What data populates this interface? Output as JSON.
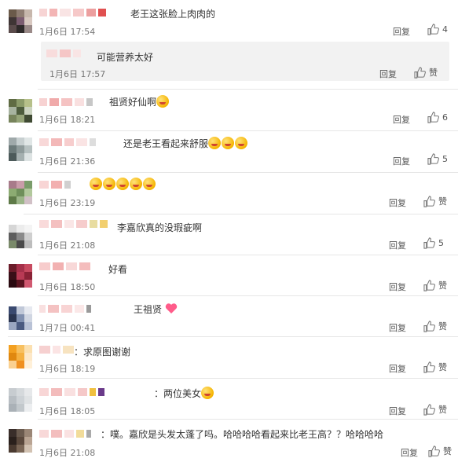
{
  "reply_label": "回复",
  "like_label": "赞",
  "comments": [
    {
      "text": "老王这张脸上肉肉的",
      "time": "1月6日 17:54",
      "likes": "4",
      "emoji_count": 0
    },
    {
      "text": "可能营养太好",
      "time": "1月6日 17:57",
      "likes": "赞",
      "emoji_count": 0,
      "is_reply": true
    },
    {
      "text": "祖贤好仙啊",
      "time": "1月6日 18:21",
      "likes": "6",
      "emoji_count": 1
    },
    {
      "text": "还是老王看起来舒服",
      "time": "1月6日 21:36",
      "likes": "5",
      "emoji_count": 3
    },
    {
      "text": "",
      "time": "1月6日 23:19",
      "likes": "赞",
      "emoji_count": 5
    },
    {
      "text": "李嘉欣真的没瑕疵啊",
      "time": "1月6日 21:08",
      "likes": "5",
      "emoji_count": 0
    },
    {
      "text": "好看",
      "time": "1月6日 18:50",
      "likes": "赞",
      "emoji_count": 0
    },
    {
      "text": "王祖贤",
      "time": "1月7日 00:41",
      "likes": "赞",
      "emoji_count": 0,
      "heart": true
    },
    {
      "text": "求原图谢谢",
      "time": "1月6日 18:19",
      "likes": "赞",
      "emoji_count": 0
    },
    {
      "text": "两位美女",
      "time": "1月6日 18:05",
      "likes": "赞",
      "emoji_count": 1
    },
    {
      "text": "噗。嘉欣是头发太蓬了吗。哈哈哈哈看起来比老王高？？哈哈哈哈",
      "time": "1月6日 21:08",
      "likes": "赞",
      "emoji_count": 0
    }
  ]
}
